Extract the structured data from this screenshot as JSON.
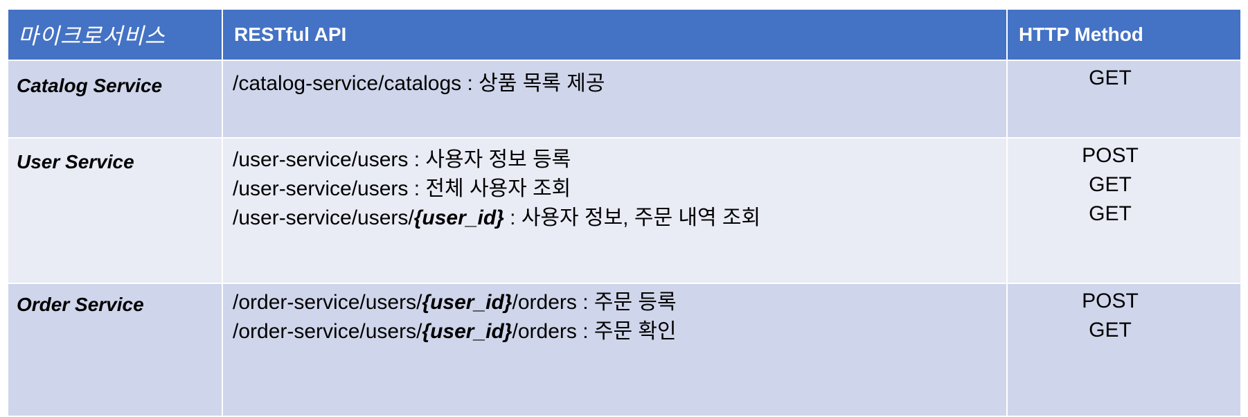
{
  "header": {
    "col1": "마이크로서비스",
    "col2": "RESTful API",
    "col3": "HTTP Method"
  },
  "rows": [
    {
      "service": "Catalog Service",
      "apis": [
        {
          "prefix": "/catalog-service/catalogs : 상품 목록 제공",
          "param": "",
          "suffix": ""
        }
      ],
      "methods": [
        "GET"
      ]
    },
    {
      "service": "User Service",
      "apis": [
        {
          "prefix": "/user-service/users : 사용자 정보 등록",
          "param": "",
          "suffix": ""
        },
        {
          "prefix": "/user-service/users : 전체 사용자 조회",
          "param": "",
          "suffix": ""
        },
        {
          "prefix": "/user-service/users/",
          "param": "{user_id}",
          "suffix": " : 사용자 정보, 주문 내역 조회"
        }
      ],
      "methods": [
        "POST",
        "GET",
        "GET"
      ]
    },
    {
      "service": "Order Service",
      "apis": [
        {
          "prefix": "/order-service/users/",
          "param": "{user_id}",
          "suffix": "/orders : 주문 등록"
        },
        {
          "prefix": "/order-service/users/",
          "param": "{user_id}",
          "suffix": "/orders : 주문 확인"
        }
      ],
      "methods": [
        "POST",
        "GET"
      ]
    }
  ]
}
